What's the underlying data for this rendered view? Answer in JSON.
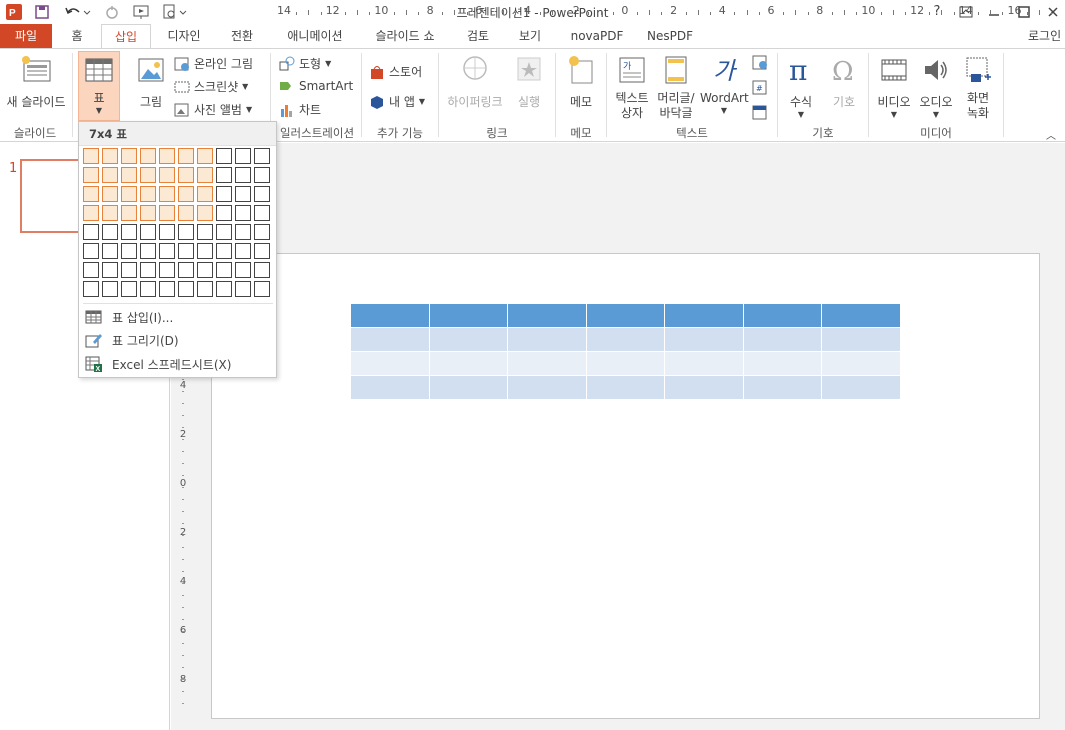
{
  "window": {
    "title": "프레젠테이션1 - PowerPoint",
    "help": "?",
    "controls": [
      "ribbon-display",
      "minimize",
      "maximize",
      "close"
    ]
  },
  "tabs": {
    "file": "파일",
    "items": [
      "홈",
      "삽입",
      "디자인",
      "전환",
      "애니메이션",
      "슬라이드 쇼",
      "검토",
      "보기",
      "novaPDF",
      "NesPDF"
    ],
    "active": "삽입",
    "login": "로그인"
  },
  "ribbon": {
    "slides": {
      "new_slide": "새 슬라이드",
      "label": "슬라이드"
    },
    "table": {
      "button": "표"
    },
    "images": {
      "picture": "그림",
      "online_picture": "온라인 그림",
      "screenshot": "스크린샷",
      "photo_album": "사진 앨범"
    },
    "illustrations": {
      "shapes": "도형",
      "smartart": "SmartArt",
      "chart": "차트",
      "label": "일러스트레이션"
    },
    "addins": {
      "store": "스토어",
      "my_apps": "내 앱",
      "label": "추가 기능"
    },
    "links": {
      "hyperlink": "하이퍼링크",
      "action": "실행",
      "label": "링크"
    },
    "comments": {
      "comment": "메모",
      "label": "메모"
    },
    "text": {
      "textbox_1": "텍스트",
      "textbox_2": "상자",
      "header_1": "머리글/",
      "header_2": "바닥글",
      "wordart": "WordArt",
      "label": "텍스트"
    },
    "symbols": {
      "equation": "수식",
      "symbol": "기호",
      "label": "기호"
    },
    "media": {
      "video": "비디오",
      "audio": "오디오",
      "screen_1": "화면",
      "screen_2": "녹화",
      "label": "미디어"
    }
  },
  "dropdown": {
    "header": "7x4 표",
    "cols": 10,
    "rows": 8,
    "hl_cols": 7,
    "hl_rows": 4,
    "items": [
      "표 삽입(I)...",
      "표 그리기(D)",
      "Excel 스프레드시트(X)"
    ]
  },
  "thumbs": {
    "slide_number": "1"
  },
  "ruler": {
    "h_labels": [
      "14",
      "12",
      "10",
      "8",
      "6",
      "4",
      "2",
      "0",
      "2",
      "4",
      "6",
      "8",
      "10",
      "12",
      "14",
      "16"
    ],
    "v_labels": [
      "4",
      "2",
      "0",
      "2",
      "4",
      "6",
      "8"
    ]
  },
  "slide_table": {
    "cols": 7,
    "rows": 4,
    "header_color": "#5b9bd5",
    "row_colors": [
      "#d2dff0",
      "#e9eff7",
      "#d2dff0"
    ]
  },
  "colors": {
    "accent": "#d24726",
    "highlight": "#e7823b"
  }
}
